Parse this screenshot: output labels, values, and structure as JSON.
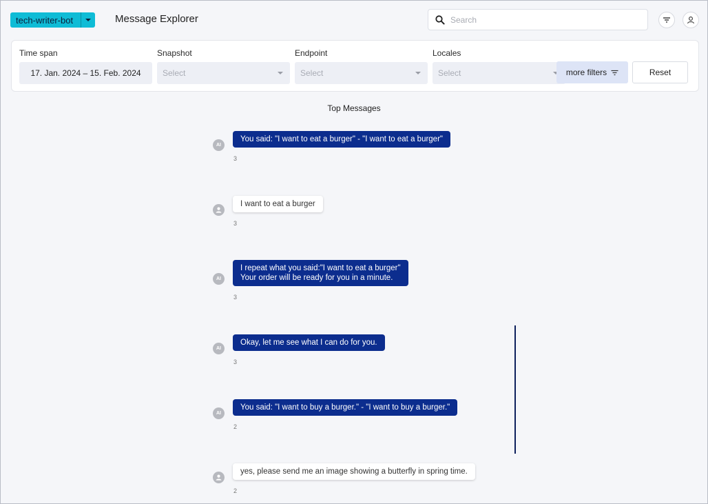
{
  "header": {
    "bot_name": "tech-writer-bot",
    "app_title": "Message Explorer",
    "search_placeholder": "Search"
  },
  "filters": {
    "time_span": {
      "label": "Time span",
      "value": "17. Jan. 2024 – 15. Feb. 2024"
    },
    "snapshot": {
      "label": "Snapshot",
      "placeholder": "Select"
    },
    "endpoint": {
      "label": "Endpoint",
      "placeholder": "Select"
    },
    "locales": {
      "label": "Locales",
      "placeholder": "Select"
    },
    "more_filters_label": "more filters",
    "reset_label": "Reset"
  },
  "section_title": "Top Messages",
  "messages": [
    {
      "sender": "bot",
      "avatar": "AI",
      "lines": [
        "You said: \"I want to eat a burger\" - \"I want to eat a burger\""
      ],
      "count": "3"
    },
    {
      "sender": "user",
      "avatar": "user-icon",
      "lines": [
        "I want to eat a burger"
      ],
      "count": "3"
    },
    {
      "sender": "bot",
      "avatar": "AI",
      "lines": [
        "I repeat what you said:\"I want to eat a burger\"",
        "Your order will be ready for you in a minute."
      ],
      "count": "3"
    },
    {
      "sender": "bot",
      "avatar": "AI",
      "lines": [
        "Okay, let me see what I can do for you."
      ],
      "count": "3"
    },
    {
      "sender": "bot",
      "avatar": "AI",
      "lines": [
        "You said: \"I want to buy a burger.\" - \"I want to buy a burger.\""
      ],
      "count": "2"
    },
    {
      "sender": "user",
      "avatar": "user-icon",
      "lines": [
        "yes, please send me an image showing a butterfly in spring time."
      ],
      "count": "2"
    }
  ]
}
